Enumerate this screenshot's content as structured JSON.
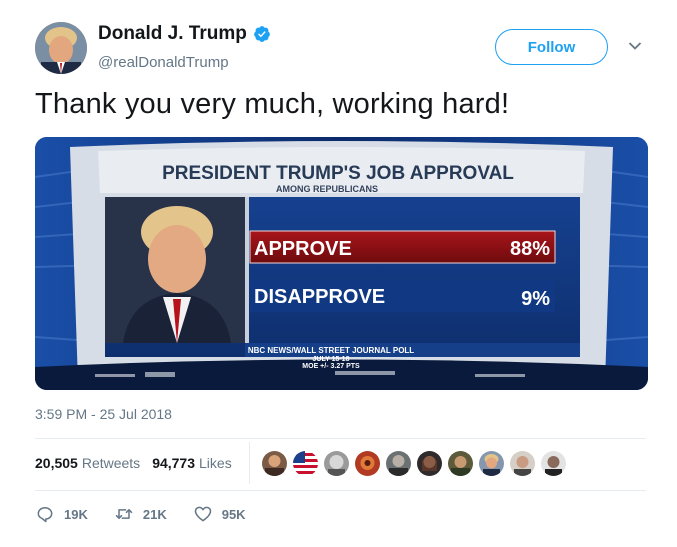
{
  "user": {
    "name": "Donald J. Trump",
    "handle": "@realDonaldTrump",
    "avatar": "profile-photo"
  },
  "follow_label": "Follow",
  "tweet_text": "Thank you very much, working hard!",
  "media": {
    "headline": "PRESIDENT TRUMP'S JOB APPROVAL",
    "subhead": "AMONG REPUBLICANS",
    "rows": [
      {
        "label": "APPROVE",
        "value": "88%"
      },
      {
        "label": "DISAPPROVE",
        "value": "9%"
      }
    ],
    "source_line1": "NBC NEWS/WALL STREET JOURNAL POLL",
    "source_line2": "JULY 15-18",
    "source_line3": "MOE +/- 3.27 PTS"
  },
  "timestamp": "3:59 PM - 25 Jul 2018",
  "stats": {
    "retweets_count": "20,505",
    "retweets_label": "Retweets",
    "likes_count": "94,773",
    "likes_label": "Likes"
  },
  "actions": {
    "replies": "19K",
    "retweets": "21K",
    "likes": "95K"
  },
  "colors": {
    "accent": "#1da1f2",
    "approve_bar": "#8c0e10",
    "graphic_bg": "#0f2e6d"
  }
}
